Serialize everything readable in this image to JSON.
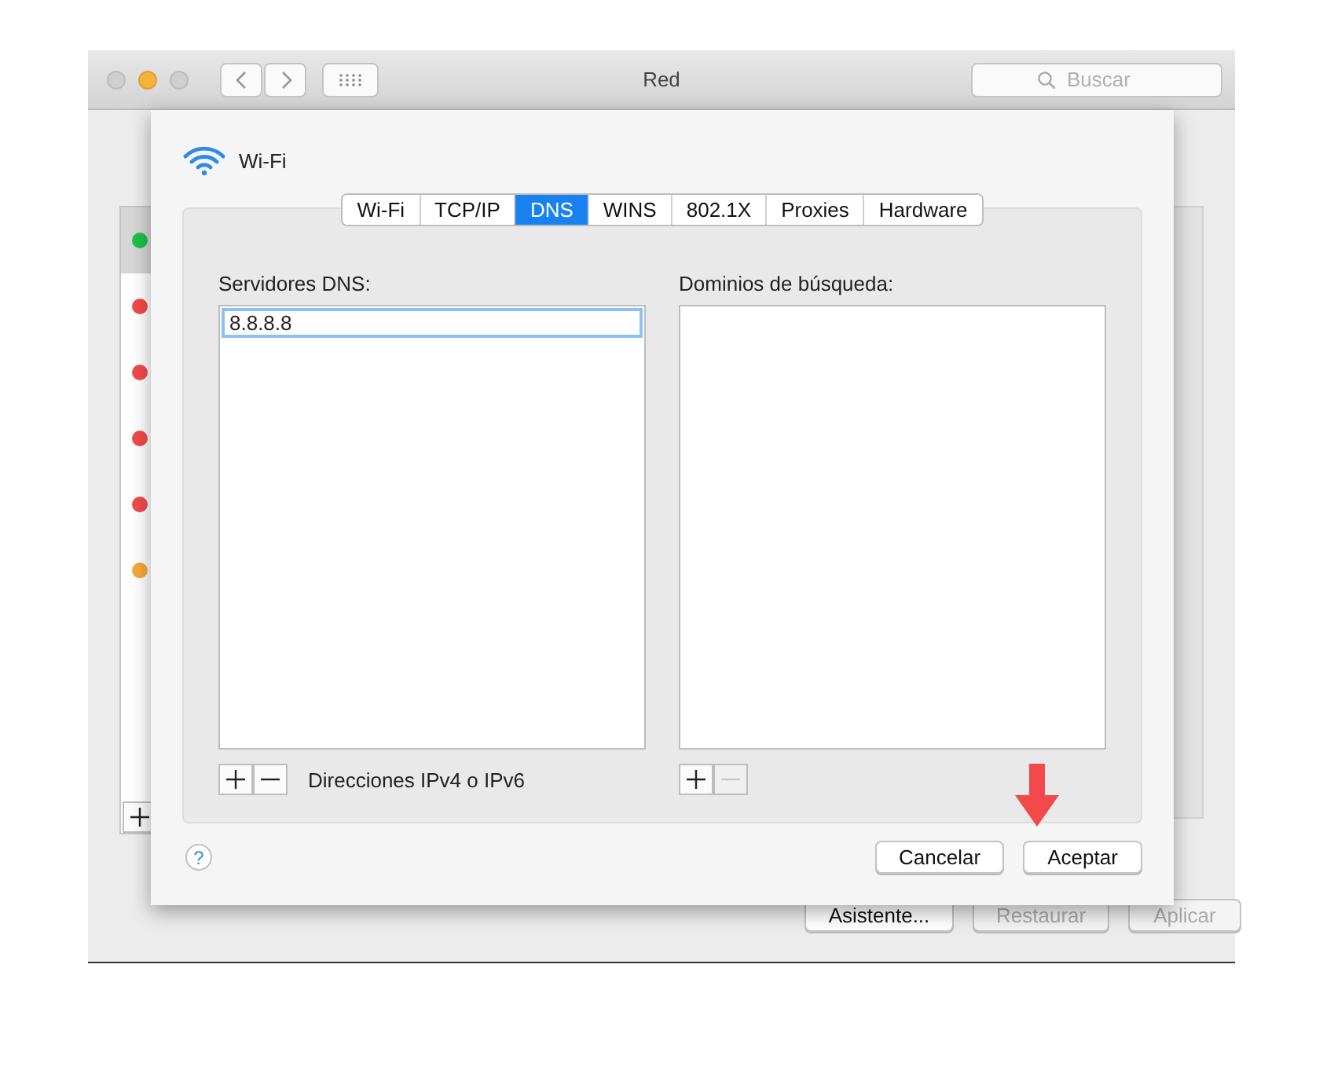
{
  "window": {
    "title": "Red",
    "search": {
      "placeholder": "Buscar"
    }
  },
  "services": [
    {
      "color": "#1fbf4a",
      "selected": true
    },
    {
      "color": "#f24a4a",
      "selected": false
    },
    {
      "color": "#f24a4a",
      "selected": false
    },
    {
      "color": "#f24a4a",
      "selected": false
    },
    {
      "color": "#f24a4a",
      "selected": false
    },
    {
      "color": "#f5a93b",
      "selected": false
    }
  ],
  "window_buttons": [
    {
      "label": "Asistente...",
      "disabled": false
    },
    {
      "label": "Restaurar",
      "disabled": true
    },
    {
      "label": "Aplicar",
      "disabled": true
    }
  ],
  "sheet": {
    "interface": "Wi-Fi",
    "tabs": [
      {
        "label": "Wi-Fi",
        "selected": false
      },
      {
        "label": "TCP/IP",
        "selected": false
      },
      {
        "label": "DNS",
        "selected": true
      },
      {
        "label": "WINS",
        "selected": false
      },
      {
        "label": "802.1X",
        "selected": false
      },
      {
        "label": "Proxies",
        "selected": false
      },
      {
        "label": "Hardware",
        "selected": false
      }
    ],
    "dns_servers": {
      "label": "Servidores DNS:",
      "entries": [
        {
          "value": "8.8.8.8",
          "selected": true
        }
      ],
      "remove_disabled": false,
      "hint": "Direcciones IPv4 o IPv6"
    },
    "search_domains": {
      "label": "Dominios de búsqueda:",
      "remove_disabled": true
    },
    "help": "?",
    "buttons": [
      "Cancelar",
      "Aceptar"
    ]
  }
}
